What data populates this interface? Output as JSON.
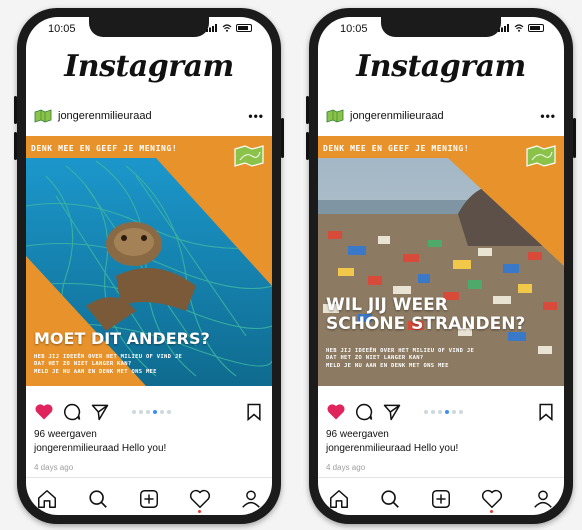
{
  "phones": [
    {
      "status_time": "10:05",
      "app_title": "Instagram",
      "account": "jongerenmilieuraad",
      "more": "•••",
      "post": {
        "banner": "DENK MEE EN GEEF JE MENING!",
        "headline_lines": [
          "MOET DIT ANDERS?"
        ],
        "sub_lines": [
          "HEB JIJ IDEEËN OVER HET MILIEU OF VIND JE",
          "DAT HET ZO NIET LANGER KAN?",
          "MELD JE NU AAN EN DENK MET ONS MEE"
        ],
        "image_subject": "sea turtle caught in a green fishing net"
      },
      "carousel_active_index": 3,
      "carousel_count": 6,
      "views": "96 weergaven",
      "caption_user": "jongerenmilieuraad",
      "caption_text": "Hello you!",
      "time": "4 days ago"
    },
    {
      "status_time": "10:05",
      "app_title": "Instagram",
      "account": "jongerenmilieuraad",
      "more": "•••",
      "post": {
        "banner": "DENK MEE EN GEEF JE MENING!",
        "headline_lines": [
          "WIL JIJ WEER",
          "SCHONE STRANDEN?"
        ],
        "sub_lines": [
          "HEB JIJ IDEEËN OVER HET MILIEU OF VIND JE",
          "DAT HET ZO NIET LANGER KAN?",
          "MELD JE NU AAN EN DENK MET ONS MEE"
        ],
        "image_subject": "beach covered in plastic litter"
      },
      "carousel_active_index": 3,
      "carousel_count": 6,
      "views": "96 weergaven",
      "caption_user": "jongerenmilieuraad",
      "caption_text": "Hello you!",
      "time": "4 days ago"
    }
  ],
  "colors": {
    "brand_orange": "#e8922c",
    "like_red": "#e0245e",
    "carousel_active": "#3d8ff4",
    "flag_green": "#8bc34a"
  },
  "tab_icons": [
    "home-icon",
    "search-icon",
    "add-post-icon",
    "activity-heart-icon",
    "profile-icon"
  ]
}
